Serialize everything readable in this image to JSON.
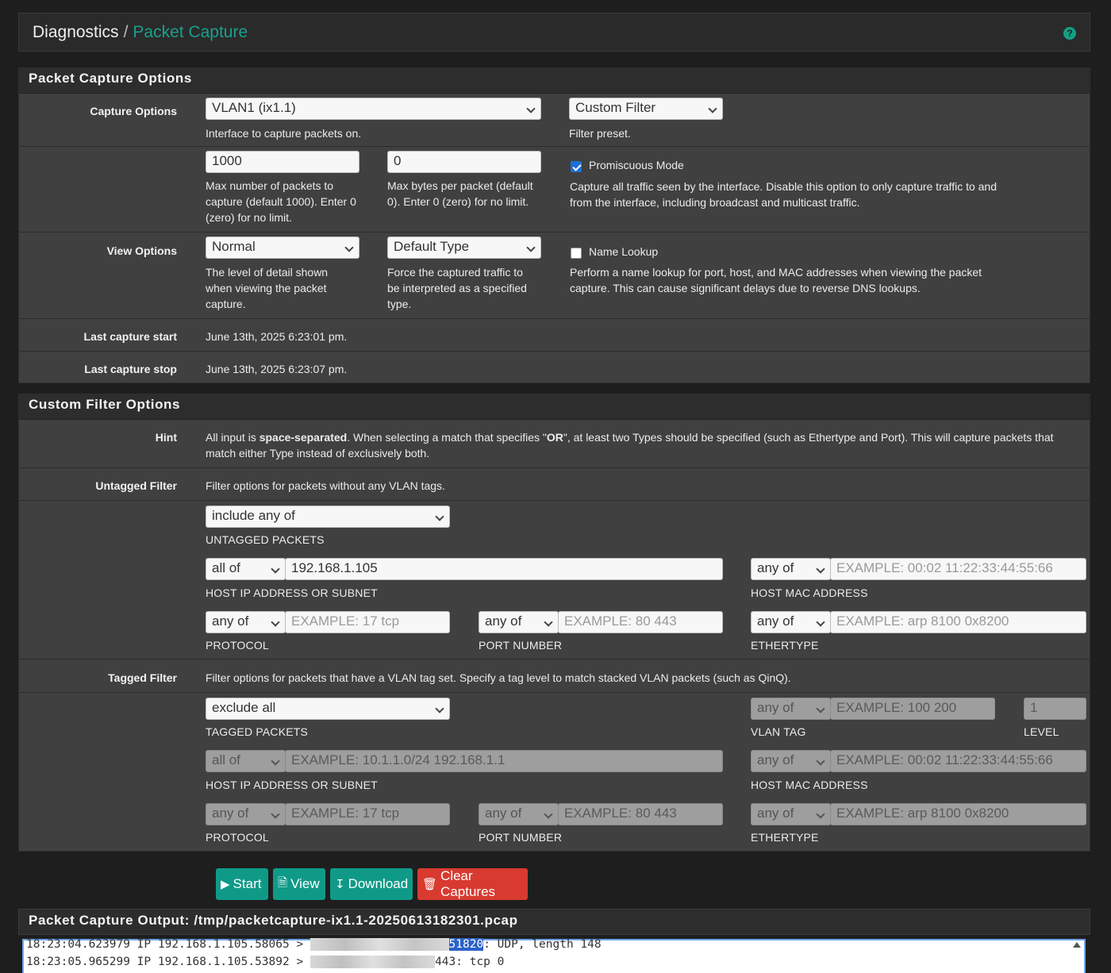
{
  "breadcrumb": {
    "root": "Diagnostics",
    "separator": "/",
    "current": "Packet Capture"
  },
  "capture_panel": {
    "title": "Packet Capture Options",
    "capture_options_label": "Capture Options",
    "interface_value": "VLAN1 (ix1.1)",
    "interface_help": "Interface to capture packets on.",
    "filter_preset_value": "Custom Filter",
    "filter_preset_help": "Filter preset.",
    "max_packets_value": "1000",
    "max_packets_help": "Max number of packets to capture (default 1000). Enter 0 (zero) for no limit.",
    "max_bytes_value": "0",
    "max_bytes_help": "Max bytes per packet (default 0). Enter 0 (zero) for no limit.",
    "promiscuous_label": "Promiscuous Mode",
    "promiscuous_checked": true,
    "promiscuous_help": "Capture all traffic seen by the interface. Disable this option to only capture traffic to and from the interface, including broadcast and multicast traffic.",
    "view_options_label": "View Options",
    "detail_value": "Normal",
    "detail_help": "The level of detail shown when viewing the packet capture.",
    "type_value": "Default Type",
    "type_help": "Force the captured traffic to be interpreted as a specified type.",
    "name_lookup_label": "Name Lookup",
    "name_lookup_checked": false,
    "name_lookup_help": "Perform a name lookup for port, host, and MAC addresses when viewing the packet capture. This can cause significant delays due to reverse DNS lookups.",
    "last_start_label": "Last capture start",
    "last_start_value": "June 13th, 2025 6:23:01 pm.",
    "last_stop_label": "Last capture stop",
    "last_stop_value": "June 13th, 2025 6:23:07 pm."
  },
  "filter_panel": {
    "title": "Custom Filter Options",
    "hint_label": "Hint",
    "hint_pre": "All input is ",
    "hint_bold1": "space-separated",
    "hint_mid": ". When selecting a match that specifies \"",
    "hint_bold2": "OR",
    "hint_post": "\", at least two Types should be specified (such as Ethertype and Port). This will capture packets that match either Type instead of exclusively both.",
    "untagged_label": "Untagged Filter",
    "untagged_desc": "Filter options for packets without any VLAN tags.",
    "untagged_mode": "include any of",
    "untagged_mode_caption": "UNTAGGED PACKETS",
    "u_host_match": "all of",
    "u_host_value": "192.168.1.105",
    "u_host_caption": "HOST IP ADDRESS OR SUBNET",
    "u_mac_match": "any of",
    "u_mac_placeholder": "EXAMPLE: 00:02 11:22:33:44:55:66",
    "u_mac_caption": "HOST MAC ADDRESS",
    "u_proto_match": "any of",
    "u_proto_placeholder": "EXAMPLE: 17 tcp",
    "u_proto_caption": "PROTOCOL",
    "u_port_match": "any of",
    "u_port_placeholder": "EXAMPLE: 80 443",
    "u_port_caption": "PORT NUMBER",
    "u_ether_match": "any of",
    "u_ether_placeholder": "EXAMPLE: arp 8100 0x8200",
    "u_ether_caption": "ETHERTYPE",
    "tagged_label": "Tagged Filter",
    "tagged_desc": "Filter options for packets that have a VLAN tag set. Specify a tag level to match stacked VLAN packets (such as QinQ).",
    "tagged_mode": "exclude all",
    "tagged_mode_caption": "TAGGED PACKETS",
    "t_vlan_match": "any of",
    "t_vlan_placeholder": "EXAMPLE: 100 200",
    "t_vlan_caption": "VLAN TAG",
    "t_level_value": "1",
    "t_level_caption": "LEVEL",
    "t_host_match": "all of",
    "t_host_placeholder": "EXAMPLE: 10.1.1.0/24 192.168.1.1",
    "t_host_caption": "HOST IP ADDRESS OR SUBNET",
    "t_mac_match": "any of",
    "t_mac_placeholder": "EXAMPLE: 00:02 11:22:33:44:55:66",
    "t_mac_caption": "HOST MAC ADDRESS",
    "t_proto_match": "any of",
    "t_proto_placeholder": "EXAMPLE: 17 tcp",
    "t_proto_caption": "PROTOCOL",
    "t_port_match": "any of",
    "t_port_placeholder": "EXAMPLE: 80 443",
    "t_port_caption": "PORT NUMBER",
    "t_ether_match": "any of",
    "t_ether_placeholder": "EXAMPLE: arp 8100 0x8200",
    "t_ether_caption": "ETHERTYPE"
  },
  "actions": {
    "start": "Start",
    "view": "View",
    "download": "Download",
    "clear": "Clear Captures"
  },
  "output": {
    "title": "Packet Capture Output: /tmp/packetcapture-ix1.1-20250613182301.pcap",
    "lines": [
      {
        "pre": "18:23:04.623979 IP 192.168.1.105.58065 > ",
        "hidden": "xxxxxxxxxxxxxxxxxxxx",
        "port": "51820",
        "post": ": UDP, length 148"
      },
      {
        "pre": "18:23:05.965299 IP 192.168.1.105.53892 > ",
        "hidden": "xxxxxxxxxxxxxxxxxx",
        "port": "",
        "post": "443: tcp 0"
      }
    ]
  },
  "colors": {
    "accent": "#19a08c",
    "button_teal": "#0f9a87",
    "button_red": "#d83a30",
    "panel_bg": "#404040",
    "page_bg": "#1e1e1e"
  }
}
